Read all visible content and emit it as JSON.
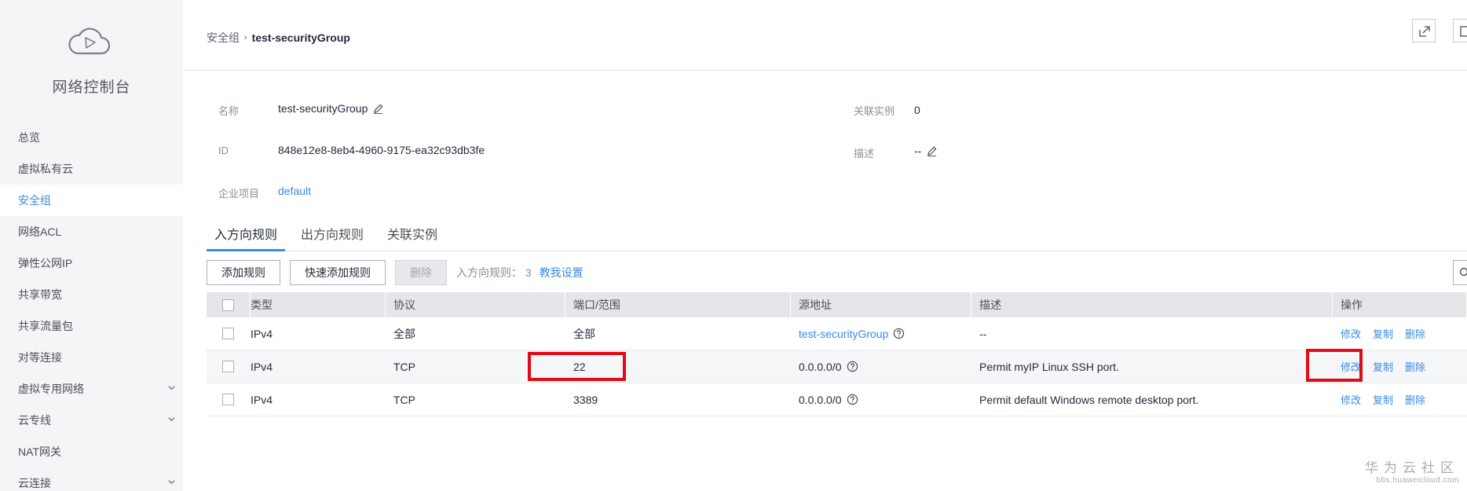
{
  "sidebar": {
    "title": "网络控制台",
    "items": [
      {
        "label": "总览",
        "active": false,
        "expandable": false
      },
      {
        "label": "虚拟私有云",
        "active": false,
        "expandable": false
      },
      {
        "label": "安全组",
        "active": true,
        "expandable": false
      },
      {
        "label": "网络ACL",
        "active": false,
        "expandable": false
      },
      {
        "label": "弹性公网IP",
        "active": false,
        "expandable": false
      },
      {
        "label": "共享带宽",
        "active": false,
        "expandable": false
      },
      {
        "label": "共享流量包",
        "active": false,
        "expandable": false
      },
      {
        "label": "对等连接",
        "active": false,
        "expandable": false
      },
      {
        "label": "虚拟专用网络",
        "active": false,
        "expandable": true
      },
      {
        "label": "云专线",
        "active": false,
        "expandable": true
      },
      {
        "label": "NAT网关",
        "active": false,
        "expandable": false
      },
      {
        "label": "云连接",
        "active": false,
        "expandable": true
      }
    ]
  },
  "breadcrumb": {
    "parent": "安全组",
    "separator": "›",
    "current": "test-securityGroup"
  },
  "info": {
    "name_label": "名称",
    "name_value": "test-securityGroup",
    "id_label": "ID",
    "id_value": "848e12e8-8eb4-4960-9175-ea32c93db3fe",
    "project_label": "企业项目",
    "project_value": "default",
    "instances_label": "关联实例",
    "instances_value": "0",
    "desc_label": "描述",
    "desc_value": "--"
  },
  "tabs": [
    {
      "label": "入方向规则",
      "active": true
    },
    {
      "label": "出方向规则",
      "active": false
    },
    {
      "label": "关联实例",
      "active": false
    }
  ],
  "toolbar": {
    "add_label": "添加规则",
    "quick_add_label": "快速添加规则",
    "delete_label": "删除",
    "count_text": "入方向规则： 3",
    "help_link": "教我设置"
  },
  "table": {
    "headers": {
      "type": "类型",
      "protocol": "协议",
      "port": "端口/范围",
      "source": "源地址",
      "description": "描述",
      "actions": "操作"
    },
    "rows": [
      {
        "type": "IPv4",
        "protocol": "全部",
        "port": "全部",
        "source": "test-securityGroup",
        "description": "--",
        "edit": "修改",
        "copy": "复制",
        "delete": "删除"
      },
      {
        "type": "IPv4",
        "protocol": "TCP",
        "port": "22",
        "source": "0.0.0.0/0",
        "description": "Permit myIP Linux SSH port.",
        "edit": "修改",
        "copy": "复制",
        "delete": "删除"
      },
      {
        "type": "IPv4",
        "protocol": "TCP",
        "port": "3389",
        "source": "0.0.0.0/0",
        "description": "Permit default Windows remote desktop port.",
        "edit": "修改",
        "copy": "复制",
        "delete": "删除"
      }
    ]
  },
  "watermark": {
    "main": "华为云社区",
    "sub": "bbs.huaweicloud.com"
  },
  "colors": {
    "accent": "#3a8be5",
    "highlight": "#e10b17",
    "sidebar_bg": "#f4f5f7"
  }
}
